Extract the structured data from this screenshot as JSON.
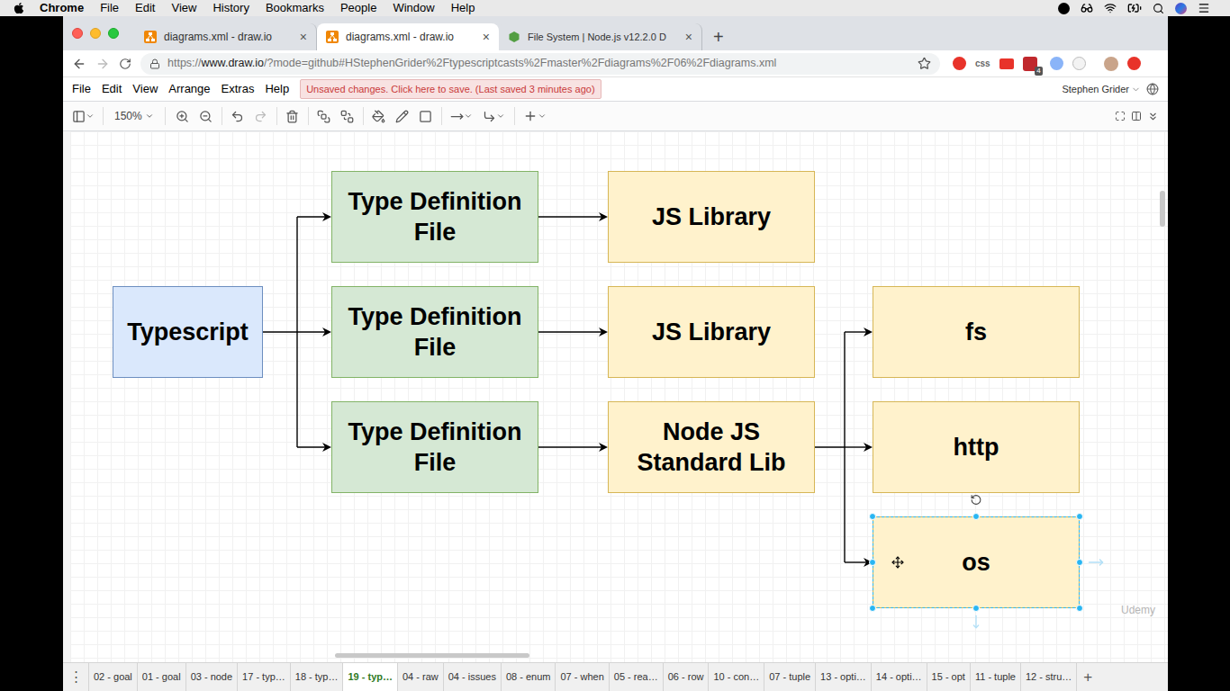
{
  "mac_menubar": {
    "app": "Chrome",
    "items": [
      "File",
      "Edit",
      "View",
      "History",
      "Bookmarks",
      "People",
      "Window",
      "Help"
    ]
  },
  "browser_tabs": [
    {
      "title": "diagrams.xml - draw.io",
      "kind": "drawio",
      "selected": false
    },
    {
      "title": "diagrams.xml - draw.io",
      "kind": "drawio",
      "selected": true
    },
    {
      "title": "File System | Node.js v12.2.0 D",
      "kind": "node",
      "selected": false
    }
  ],
  "tab_close": "×",
  "new_tab": "+",
  "url": {
    "scheme": "https://",
    "host": "www.draw.io",
    "path": "/?mode=github#HStephenGrider%2Ftypescriptcasts%2Fmaster%2Fdiagrams%2F06%2Fdiagrams.xml"
  },
  "extensions": {
    "css_label": "css",
    "badge": "4"
  },
  "drawio_menu": [
    "File",
    "Edit",
    "View",
    "Arrange",
    "Extras",
    "Help"
  ],
  "notice": "Unsaved changes. Click here to save. (Last saved 3 minutes ago)",
  "user": "Stephen Grider",
  "toolbar": {
    "zoom": "150%"
  },
  "diagram": {
    "nodes": [
      {
        "lines": [
          "Typescript"
        ],
        "kind": "root",
        "selected": false
      },
      {
        "lines": [
          "Type Definition",
          "File"
        ],
        "kind": "typedef",
        "selected": false
      },
      {
        "lines": [
          "Type Definition",
          "File"
        ],
        "kind": "typedef",
        "selected": false
      },
      {
        "lines": [
          "Type Definition",
          "File"
        ],
        "kind": "typedef",
        "selected": false
      },
      {
        "lines": [
          "JS Library"
        ],
        "kind": "library",
        "selected": false
      },
      {
        "lines": [
          "JS Library"
        ],
        "kind": "library",
        "selected": false
      },
      {
        "lines": [
          "Node JS",
          "Standard Lib"
        ],
        "kind": "library",
        "selected": false
      },
      {
        "lines": [
          "fs"
        ],
        "kind": "library",
        "selected": false
      },
      {
        "lines": [
          "http"
        ],
        "kind": "library",
        "selected": false
      },
      {
        "lines": [
          "os"
        ],
        "kind": "library",
        "selected": true
      }
    ]
  },
  "watermark": "Udemy",
  "page_menu": "⋮",
  "add_page": "+",
  "page_tabs": [
    {
      "label": "02 - goal",
      "selected": false
    },
    {
      "label": "01 - goal",
      "selected": false
    },
    {
      "label": "03 - node",
      "selected": false
    },
    {
      "label": "17 - typ…",
      "selected": false
    },
    {
      "label": "18 - typ…",
      "selected": false
    },
    {
      "label": "19 - typ…",
      "selected": true
    },
    {
      "label": "04 - raw",
      "selected": false
    },
    {
      "label": "04 - issues",
      "selected": false
    },
    {
      "label": "08 - enum",
      "selected": false
    },
    {
      "label": "07 - when",
      "selected": false
    },
    {
      "label": "05 - rea…",
      "selected": false
    },
    {
      "label": "06 - row",
      "selected": false
    },
    {
      "label": "10 - con…",
      "selected": false
    },
    {
      "label": "07 - tuple",
      "selected": false
    },
    {
      "label": "13 - opti…",
      "selected": false
    },
    {
      "label": "14 - opti…",
      "selected": false
    },
    {
      "label": "15 - opt",
      "selected": false
    },
    {
      "label": "11 - tuple",
      "selected": false
    },
    {
      "label": "12 - stru…",
      "selected": false
    }
  ]
}
